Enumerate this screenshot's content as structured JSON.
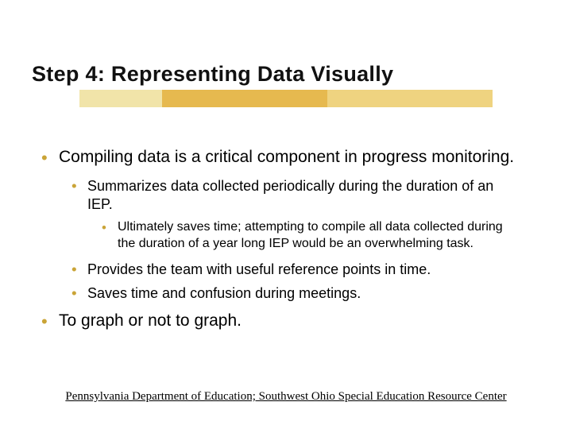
{
  "title": "Step 4: Representing Data Visually",
  "bullets": {
    "b1": "Compiling data is a critical component in progress monitoring.",
    "b1_1": "Summarizes data collected periodically during the duration of an IEP.",
    "b1_1_1": "Ultimately saves time; attempting to compile all data collected during the duration of a year long IEP would be an overwhelming task.",
    "b1_2": "Provides the team with useful reference points in time.",
    "b1_3": "Saves time and confusion during meetings.",
    "b2": "To graph or not to graph."
  },
  "footer": "Pennsylvania Department of Education; Southwest Ohio Special Education Resource Center"
}
